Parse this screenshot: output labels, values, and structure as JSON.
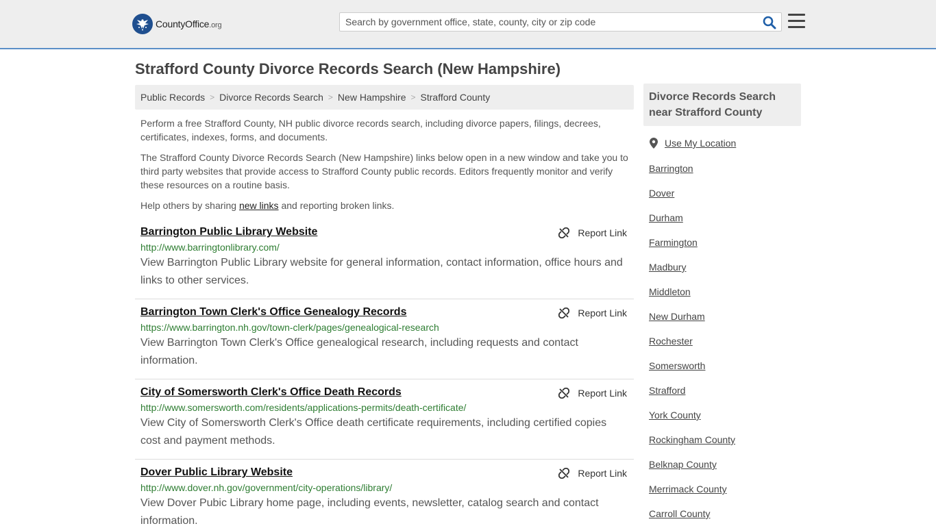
{
  "header": {
    "logo_brand": "CountyOffice",
    "logo_tld": ".org",
    "search_placeholder": "Search by government office, state, county, city or zip code"
  },
  "page_title": "Strafford County Divorce Records Search (New Hampshire)",
  "breadcrumb": [
    "Public Records",
    "Divorce Records Search",
    "New Hampshire",
    "Strafford County"
  ],
  "intro": {
    "p1": "Perform a free Strafford County, NH public divorce records search, including divorce papers, filings, decrees, certificates, indexes, forms, and documents.",
    "p2": "The Strafford County Divorce Records Search (New Hampshire) links below open in a new window and take you to third party websites that provide access to Strafford County public records. Editors frequently monitor and verify these resources on a routine basis.",
    "p3_before": "Help others by sharing ",
    "p3_link": "new links",
    "p3_after": " and reporting broken links."
  },
  "report_label": "Report Link",
  "results": [
    {
      "title": "Barrington Public Library Website",
      "url": "http://www.barringtonlibrary.com/",
      "desc": "View Barrington Public Library website for general information, contact information, office hours and links to other services."
    },
    {
      "title": "Barrington Town Clerk's Office Genealogy Records",
      "url": "https://www.barrington.nh.gov/town-clerk/pages/genealogical-research",
      "desc": "View Barrington Town Clerk's Office genealogical research, including requests and contact information."
    },
    {
      "title": "City of Somersworth Clerk's Office Death Records",
      "url": "http://www.somersworth.com/residents/applications-permits/death-certificate/",
      "desc": "View City of Somersworth Clerk's Office death certificate requirements, including certified copies cost and payment methods."
    },
    {
      "title": "Dover Public Library Website",
      "url": "http://www.dover.nh.gov/government/city-operations/library/",
      "desc": "View Dover Pubic Library home page, including events, newsletter, catalog search and contact information."
    }
  ],
  "sidebar": {
    "heading": "Divorce Records Search near Strafford County",
    "use_location": "Use My Location",
    "links": [
      "Barrington",
      "Dover",
      "Durham",
      "Farmington",
      "Madbury",
      "Middleton",
      "New Durham",
      "Rochester",
      "Somersworth",
      "Strafford",
      "York County",
      "Rockingham County",
      "Belknap County",
      "Merrimack County",
      "Carroll County"
    ]
  }
}
